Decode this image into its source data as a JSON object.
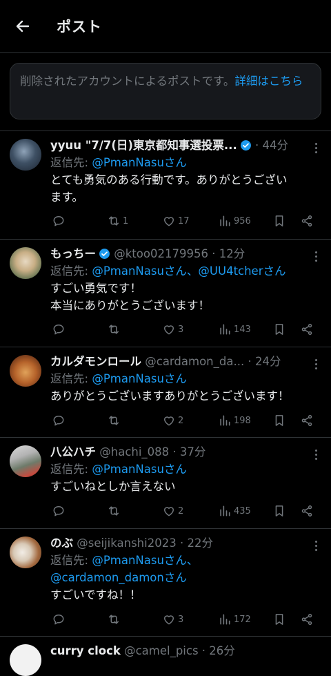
{
  "header": {
    "title": "ポスト"
  },
  "notice": {
    "text": "削除されたアカウントによるポストです。",
    "link": "詳細はこちら"
  },
  "posts": [
    {
      "name": "yyuu \"7/7(日)東京都知事選投票...",
      "handle": "",
      "time": "· 44分",
      "reply_label": "返信先: ",
      "reply_to": "@PmanNasuさん",
      "reply_to_line2": "",
      "text": "とても勇気のある行動です。ありがとうござい\nます。",
      "counts": {
        "retweets": "1",
        "likes": "17",
        "views": "956"
      }
    },
    {
      "name": "もっちー",
      "handle": "@ktoo02179956",
      "time": "· 12分",
      "reply_label": "返信先: ",
      "reply_to": "@PmanNasuさん、@UU4tcherさん",
      "reply_to_line2": "",
      "text": "すごい勇気です！\n本当にありがとうございます！",
      "counts": {
        "retweets": "",
        "likes": "3",
        "views": "143"
      }
    },
    {
      "name": "カルダモンロール",
      "handle": "@cardamon_da...",
      "time": "· 24分",
      "reply_label": "返信先: ",
      "reply_to": "@PmanNasuさん",
      "reply_to_line2": "",
      "text": "ありがとうございますありがとうございます！",
      "counts": {
        "retweets": "",
        "likes": "2",
        "views": "198"
      }
    },
    {
      "name": "八公ハチ",
      "handle": "@hachi_088",
      "time": "· 37分",
      "reply_label": "返信先: ",
      "reply_to": "@PmanNasuさん",
      "reply_to_line2": "",
      "text": "すごいねとしか言えない",
      "counts": {
        "retweets": "",
        "likes": "2",
        "views": "435"
      }
    },
    {
      "name": "のぶ",
      "handle": "@seijikanshi2023",
      "time": "· 22分",
      "reply_label": "返信先: ",
      "reply_to": "@PmanNasuさん、",
      "reply_to_line2": "@cardamon_damonさん",
      "text": "すごいですね！！",
      "counts": {
        "retweets": "",
        "likes": "3",
        "views": "172"
      }
    },
    {
      "name": "curry clock",
      "handle": "@camel_pics",
      "time": "· 26分"
    }
  ],
  "colors": {
    "background": "#000000",
    "accent": "#1d9bf0",
    "muted": "#71767b",
    "verified": "#1d9bf0",
    "divider": "#2f3336"
  }
}
